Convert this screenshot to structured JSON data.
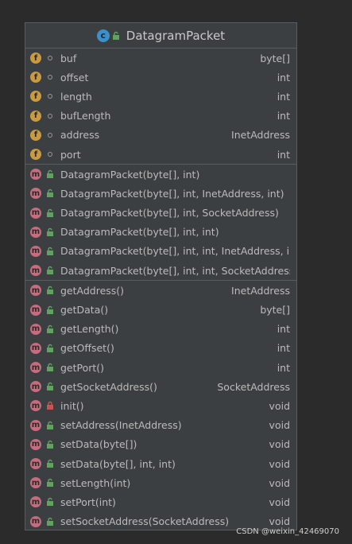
{
  "class": {
    "name": "DatagramPacket",
    "kind_icon": "class-icon"
  },
  "fields": [
    {
      "name": "buf",
      "type": "byte[]"
    },
    {
      "name": "offset",
      "type": "int"
    },
    {
      "name": "length",
      "type": "int"
    },
    {
      "name": "bufLength",
      "type": "int"
    },
    {
      "name": "address",
      "type": "InetAddress"
    },
    {
      "name": "port",
      "type": "int"
    }
  ],
  "constructors": [
    {
      "name": "DatagramPacket(byte[], int)",
      "type": ""
    },
    {
      "name": "DatagramPacket(byte[], int, InetAddress, int)",
      "type": ""
    },
    {
      "name": "DatagramPacket(byte[], int, SocketAddress)",
      "type": ""
    },
    {
      "name": "DatagramPacket(byte[], int, int)",
      "type": ""
    },
    {
      "name": "DatagramPacket(byte[], int, int, InetAddress, int)",
      "type": ""
    },
    {
      "name": "DatagramPacket(byte[], int, int, SocketAddress)",
      "type": ""
    }
  ],
  "methods": [
    {
      "name": "getAddress()",
      "type": "InetAddress",
      "visibility": "public"
    },
    {
      "name": "getData()",
      "type": "byte[]",
      "visibility": "public"
    },
    {
      "name": "getLength()",
      "type": "int",
      "visibility": "public"
    },
    {
      "name": "getOffset()",
      "type": "int",
      "visibility": "public"
    },
    {
      "name": "getPort()",
      "type": "int",
      "visibility": "public"
    },
    {
      "name": "getSocketAddress()",
      "type": "SocketAddress",
      "visibility": "public"
    },
    {
      "name": "init()",
      "type": "void",
      "visibility": "private"
    },
    {
      "name": "setAddress(InetAddress)",
      "type": "void",
      "visibility": "public"
    },
    {
      "name": "setData(byte[])",
      "type": "void",
      "visibility": "public"
    },
    {
      "name": "setData(byte[], int, int)",
      "type": "void",
      "visibility": "public"
    },
    {
      "name": "setLength(int)",
      "type": "void",
      "visibility": "public"
    },
    {
      "name": "setPort(int)",
      "type": "void",
      "visibility": "public"
    },
    {
      "name": "setSocketAddress(SocketAddress)",
      "type": "void",
      "visibility": "public"
    }
  ],
  "watermark": "CSDN @weixin_42469070",
  "colors": {
    "background": "#2b2b2b",
    "card": "#3c3f41",
    "field_icon": "#c99a3f",
    "method_icon": "#c56c7e",
    "class_icon": "#3d8fc9",
    "public_lock": "#5fa35f",
    "private_lock": "#c75450"
  }
}
